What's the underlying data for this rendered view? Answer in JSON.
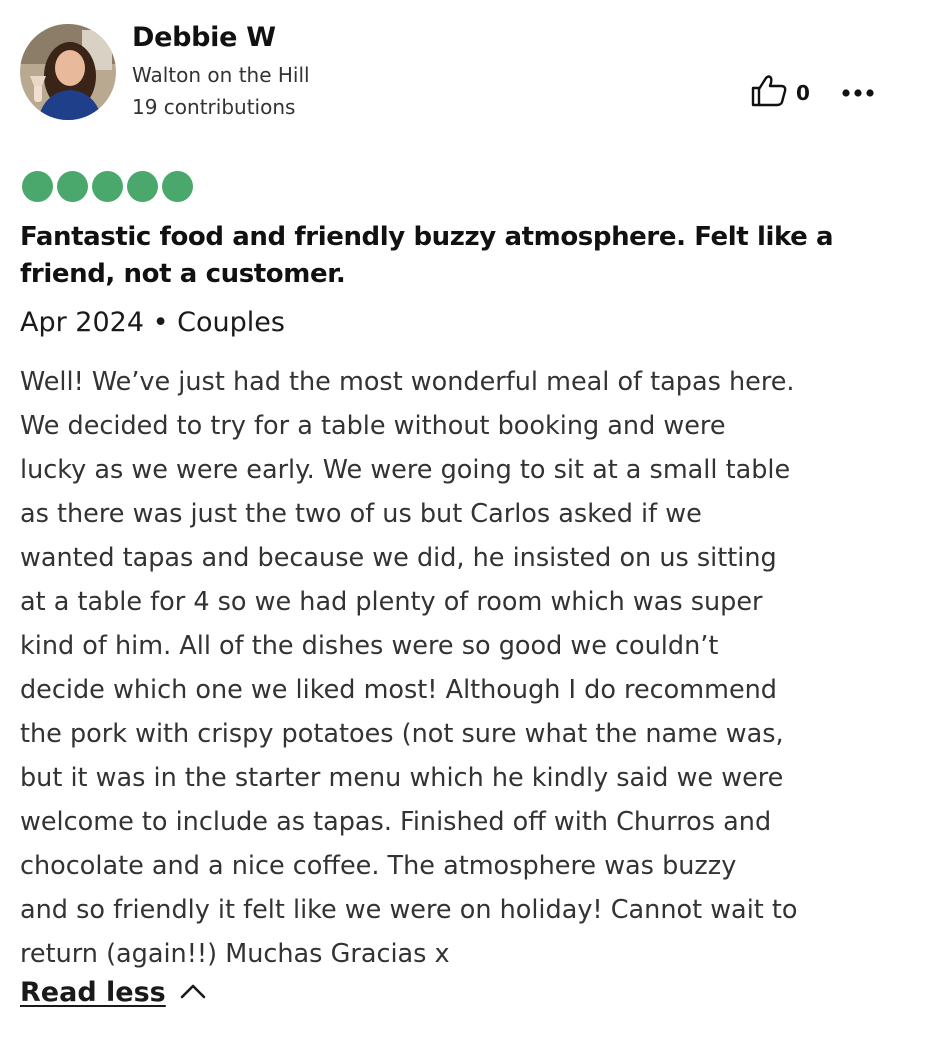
{
  "reviewer": {
    "name": "Debbie W",
    "location": "Walton on the Hill",
    "contributions": "19 contributions"
  },
  "actions": {
    "helpful_count": "0"
  },
  "rating": {
    "bubbles": 5,
    "out_of": 5,
    "color": "#4aa86c"
  },
  "review": {
    "title": "Fantastic food and friendly buzzy atmosphere. Felt like a friend, not a customer.",
    "meta": "Apr 2024 • Couples",
    "body_lines": [
      "Well! We’ve just had the most wonderful meal of tapas here.",
      "We decided to try for a table without booking and were",
      "lucky as we were early. We were going to sit at a small table",
      "as there was just the two of us but Carlos asked if we",
      "wanted tapas and because we did, he insisted on us sitting",
      "at a table for 4 so we had plenty of room which was super",
      "kind of him. All of the dishes were so good we couldn’t",
      "decide which one we liked most! Although I do recommend",
      "the pork with crispy potatoes (not sure what the name was,",
      "but it was in the starter menu which he kindly said we were",
      "welcome to include as tapas. Finished off with Churros and",
      "chocolate and a nice coffee. The atmosphere was buzzy",
      "and so friendly it felt like we were on holiday! Cannot wait to",
      "return (again!!) Muchas Gracias x"
    ],
    "read_less_label": "Read less"
  },
  "icons": {
    "thumbs_up": "thumbs-up-icon",
    "more": "more-options-icon",
    "chevron": "chevron-up-icon"
  }
}
